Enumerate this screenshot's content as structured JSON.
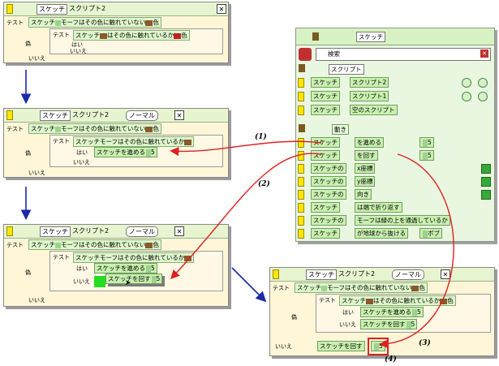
{
  "panel1": {
    "title": {
      "name": "スケッチ",
      "script": "スクリプト2"
    },
    "test_label": "テスト",
    "condition": {
      "subject": "スケッチ",
      "text": "モーフはその色に触れていない",
      "suffix": "色"
    },
    "no_label": "偽",
    "inner": {
      "test": "テスト",
      "subject": "スケッチ",
      "text": "はその色に触れているか",
      "suffix": "色",
      "yes": "はい",
      "no": "いいえ"
    },
    "no_bottom": "いいえ"
  },
  "panel2": {
    "title": {
      "name": "スケッチ",
      "script": "スクリプト2",
      "mode": "ノーマル"
    },
    "test_label": "テスト",
    "condition": {
      "subject": "スケッチ",
      "text": "モーフはその色に触れていない",
      "suffix": "色"
    },
    "no_label": "偽",
    "inner": {
      "test": "テスト",
      "subject": "スケッチ",
      "text": "モーフはその色に触れているか",
      "yes": "はい",
      "no": "いいえ"
    },
    "yes_action": {
      "subject": "スケッチ",
      "verb": "を進める",
      "value": "5"
    },
    "no_bottom": "いいえ"
  },
  "panel3": {
    "title": {
      "name": "スケッチ",
      "script": "スクリプト2",
      "mode": "ノーマル"
    },
    "test_label": "テスト",
    "condition": {
      "subject": "スケッチ",
      "text": "モーフはその色に触れていない",
      "suffix": "色"
    },
    "no_label": "偽",
    "inner": {
      "test": "テスト",
      "subject": "スケッチ",
      "text": "モーフはその色に触れているか",
      "yes": "はい",
      "no": "いいえ"
    },
    "yes_action": {
      "subject": "スケッチ",
      "verb": "を進める",
      "value": "5"
    },
    "no_action": {
      "subject": "スケッチ",
      "verb": "を回す",
      "value": "5"
    },
    "no_bottom": "いいえ"
  },
  "panel4": {
    "title": {
      "name": "スケッチ",
      "script": "スクリプト2",
      "mode": "ノーマル"
    },
    "test_label": "テスト",
    "condition": {
      "subject": "スケッチ",
      "text": "モーフはその色に触れていない",
      "suffix": "色"
    },
    "no_label": "偽",
    "inner": {
      "test": "テスト",
      "subject": "スケッチ",
      "text": "はその色に触れているか",
      "suffix": "色",
      "yes": "はい",
      "no": "いいえ"
    },
    "yes_action": {
      "subject": "スケッチ",
      "verb": "を進める",
      "value": "5"
    },
    "no_action": {
      "subject": "スケッチ",
      "verb": "を回す",
      "value": "5"
    },
    "bottom": {
      "label": "いいえ",
      "subject": "スケッチ",
      "verb": "を回す",
      "value": "5"
    }
  },
  "viewer": {
    "title": "スケッチ",
    "search_value": "検索",
    "script_section": "スクリプト",
    "scripts": [
      {
        "subject": "スケッチ",
        "name": "スクリプト2"
      },
      {
        "subject": "スケッチ",
        "name": "スクリプト1"
      },
      {
        "subject": "スケッチ",
        "name": "空のスクリプト"
      }
    ],
    "motion_section": "動き",
    "motion_rows": [
      {
        "subject": "スケッチ",
        "text": "を進める",
        "value": "5"
      },
      {
        "subject": "スケッチ",
        "text": "を回す",
        "value": "5"
      },
      {
        "subject": "スケッチの",
        "text": "x座標"
      },
      {
        "subject": "スケッチの",
        "text": "y座標"
      },
      {
        "subject": "スケッチの",
        "text": "向き"
      },
      {
        "subject": "スケッチ",
        "text": "は端で折り返す"
      },
      {
        "subject": "スケッチの",
        "text": "モーフは緑の上を通過しているか"
      },
      {
        "subject": "スケッチ",
        "text": "が地球から抜ける",
        "value": "ボブ"
      }
    ]
  },
  "annotations": [
    "(1)",
    "(2)",
    "(3)",
    "(4)"
  ],
  "colors": {
    "arrow_red": "#e02020",
    "arrow_blue": "#1a2aa8",
    "titlebar": "#e6f5d0",
    "panel_bg": "#fff6d8"
  }
}
